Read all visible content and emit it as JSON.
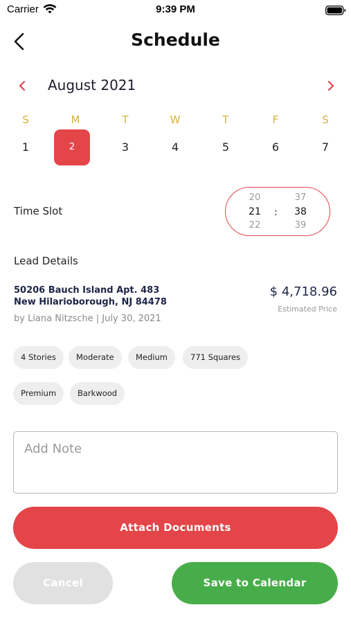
{
  "status_bar": {
    "carrier": "Carrier",
    "time": "9:39 PM"
  },
  "header": {
    "title": "Schedule"
  },
  "calendar": {
    "month": "August 2021",
    "weekdays": [
      "S",
      "M",
      "T",
      "W",
      "T",
      "F",
      "S"
    ],
    "days": [
      "1",
      "2",
      "3",
      "4",
      "5",
      "6",
      "7"
    ],
    "selected_day": "2"
  },
  "time_slot": {
    "label": "Time Slot",
    "hours": [
      "20",
      "21",
      "22"
    ],
    "minutes": [
      "37",
      "38",
      "39"
    ],
    "separator": ":"
  },
  "lead": {
    "title": "Lead Details",
    "address_line1": "50206 Bauch Island Apt. 483",
    "address_line2": "New Hilarioborough, NJ 84478",
    "by_line": "by Liana Nitzsche   | July 30, 2021",
    "price": "$ 4,718.96",
    "price_label": "Estimated Price",
    "tags": [
      "4 Stories",
      "Moderate",
      "Medium",
      "771 Squares",
      "Premium",
      "Barkwood"
    ]
  },
  "note": {
    "placeholder": "Add Note"
  },
  "actions": {
    "attach_label": "Attach Documents",
    "cancel_label": "Cancel",
    "save_label": "Save to Calendar"
  },
  "colors": {
    "accent": "#e34549",
    "weekday": "#d4b23c",
    "save": "#47ad4a",
    "cancel": "#e1e1e1"
  }
}
